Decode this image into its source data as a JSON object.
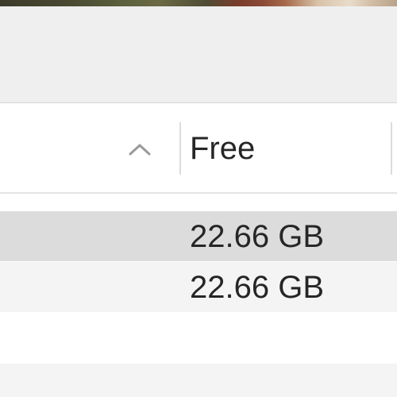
{
  "table": {
    "sort_direction": "ascending",
    "columns": {
      "free": {
        "label": "Free"
      }
    },
    "rows": [
      {
        "free": "22.66 GB",
        "selected": true
      },
      {
        "free": "22.66 GB",
        "selected": false
      }
    ]
  },
  "icons": {
    "sort": "chevron-up-icon"
  },
  "colors": {
    "selected_row": "#dcdcdc",
    "alternate_row": "#f4f4f4",
    "toolbar_bg": "#efefef"
  }
}
